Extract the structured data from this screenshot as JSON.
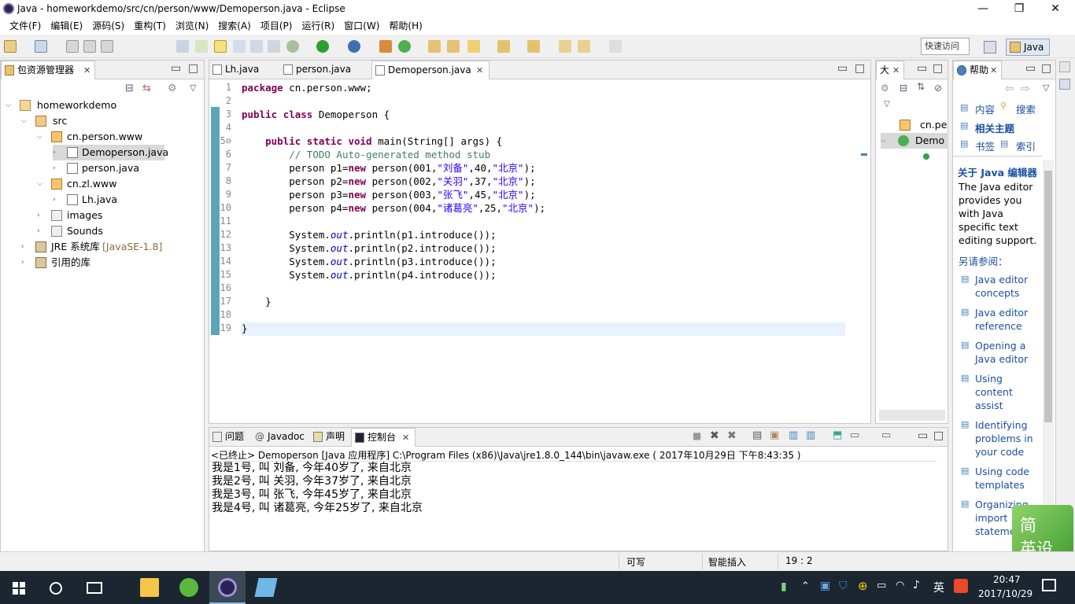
{
  "window": {
    "title": "Java  -  homeworkdemo/src/cn/person/www/Demoperson.java  -  Eclipse",
    "minimize": "—",
    "restore": "❐",
    "close": "✕"
  },
  "menu": [
    "文件(F)",
    "编辑(E)",
    "源码(S)",
    "重构(T)",
    "浏览(N)",
    "搜索(A)",
    "项目(P)",
    "运行(R)",
    "窗口(W)",
    "帮助(H)"
  ],
  "toolbar": {
    "quick_access": "快速访问",
    "perspective": "Java"
  },
  "package_explorer": {
    "tab": "包资源管理器",
    "tree": [
      {
        "label": "homeworkdemo",
        "level": 0,
        "icon": "project-icon",
        "expanded": true
      },
      {
        "label": "src",
        "level": 1,
        "icon": "source-folder-icon",
        "expanded": true
      },
      {
        "label": "cn.person.www",
        "level": 2,
        "icon": "package-icon",
        "expanded": true
      },
      {
        "label": "Demoperson.java",
        "level": 3,
        "icon": "java-file-icon",
        "selected": true
      },
      {
        "label": "person.java",
        "level": 3,
        "icon": "java-file-icon"
      },
      {
        "label": "cn.zl.www",
        "level": 2,
        "icon": "package-icon",
        "expanded": true
      },
      {
        "label": "Lh.java",
        "level": 3,
        "icon": "java-file-icon"
      },
      {
        "label": "images",
        "level": 1,
        "icon": "folder-icon"
      },
      {
        "label": "Sounds",
        "level": 1,
        "icon": "folder-icon"
      },
      {
        "label": "JRE 系统库",
        "suffix": "[JavaSE-1.8]",
        "level": 0,
        "icon": "library-icon"
      },
      {
        "label": "引用的库",
        "level": 0,
        "icon": "library-icon"
      }
    ]
  },
  "editor": {
    "tabs": [
      {
        "label": "Lh.java"
      },
      {
        "label": "person.java"
      },
      {
        "label": "Demoperson.java",
        "active": true
      }
    ],
    "line_numbers": [
      "1",
      "2",
      "3",
      "4",
      "5⊖",
      "6",
      "7",
      "8",
      "9",
      "10",
      "11",
      "12",
      "13",
      "14",
      "15",
      "16",
      "17",
      "18",
      "19"
    ],
    "cursor": "19 : 2"
  },
  "outline": {
    "tab": "大",
    "items": [
      "cn.pe",
      "Demo"
    ]
  },
  "help": {
    "tab": "帮助",
    "nav": [
      "内容",
      "搜索",
      "相关主题",
      "书签",
      "索引"
    ],
    "heading": "关于 Java 编辑器",
    "desc": "The Java editor provides you with Java specific text editing support.",
    "see_also": "另请参阅：",
    "links": [
      "Java editor concepts",
      "Java editor reference",
      "Opening a Java editor",
      "Using content assist",
      "Identifying problems in your code",
      "Using code templates",
      "Organizing import statements"
    ]
  },
  "bottom": {
    "tabs": [
      "问题",
      "Javadoc",
      "声明",
      "控制台"
    ],
    "header": "<已终止> Demoperson [Java 应用程序] C:\\Program Files (x86)\\Java\\jre1.8.0_144\\bin\\javaw.exe ( 2017年10月29日 下午8:43:35 )",
    "output": [
      "我是1号, 叫 刘备, 今年40岁了, 来自北京",
      "我是2号, 叫 关羽, 今年37岁了, 来自北京",
      "我是3号, 叫 张飞, 今年45岁了, 来自北京",
      "我是4号, 叫 诸葛亮, 今年25岁了, 来自北京"
    ]
  },
  "status": {
    "writable": "可写",
    "insert": "智能插入",
    "position": "19 : 2"
  },
  "ime": {
    "line1": "简",
    "line2": "英设"
  },
  "taskbar": {
    "time": "20:47",
    "date": "2017/10/29",
    "lang": "英"
  }
}
